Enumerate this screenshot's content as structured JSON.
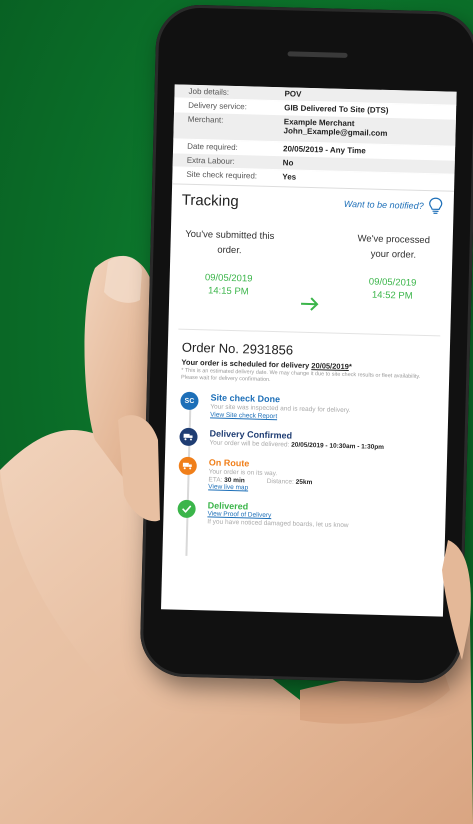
{
  "details": [
    {
      "label": "Job details:",
      "value": "POV"
    },
    {
      "label": "Delivery service:",
      "value": "GIB Delivered To Site (DTS)"
    },
    {
      "label": "Merchant:",
      "value": "Example Merchant",
      "value2": "John_Example@gmail.com"
    },
    {
      "label": "Date required:",
      "value": "20/05/2019  - Any Time"
    },
    {
      "label": "Extra Labour:",
      "value": "No"
    },
    {
      "label": "Site check required:",
      "value": "Yes"
    }
  ],
  "tracking": {
    "title": "Tracking",
    "notify_label": "Want to be notified?",
    "step1": {
      "text": "You've submitted this order.",
      "date": "09/05/2019",
      "time": "14:15 PM"
    },
    "step2": {
      "text": "We've processed your order.",
      "date": "09/05/2019",
      "time": "14:52 PM"
    }
  },
  "order": {
    "number": "Order No. 2931856",
    "scheduled_prefix": "Your order is scheduled for delivery",
    "scheduled_date": "20/05/2019",
    "fine_print": "* This is an estimated delivery date. We may change it due to site check results or fleet availability. Please wait for delivery confirmation."
  },
  "timeline": [
    {
      "badge": "SC",
      "title": "Site check Done",
      "text": "Your site was inspected and is ready for delivery.",
      "link": "View Site check Report"
    },
    {
      "badge": "",
      "title": "Delivery Confirmed",
      "text": "Your order will be delivered:",
      "text_bold": "20/05/2019 - 10:30am - 1:30pm"
    },
    {
      "badge": "",
      "title": "On Route",
      "text": "Your order is on its way.",
      "eta_label": "ETA:",
      "eta_value": "30 min",
      "distance_label": "Distance:",
      "distance_value": "25km",
      "link": "View live map"
    },
    {
      "badge": "",
      "title": "Delivered",
      "link": "View Proof of Delivery",
      "text": "If you have noticed damaged boards, let us know"
    }
  ],
  "colors": {
    "background": "#0d7a2e",
    "link_blue": "#1d6fb8",
    "navy": "#1f3d73",
    "orange": "#f07f1a",
    "green": "#3bb54a"
  }
}
